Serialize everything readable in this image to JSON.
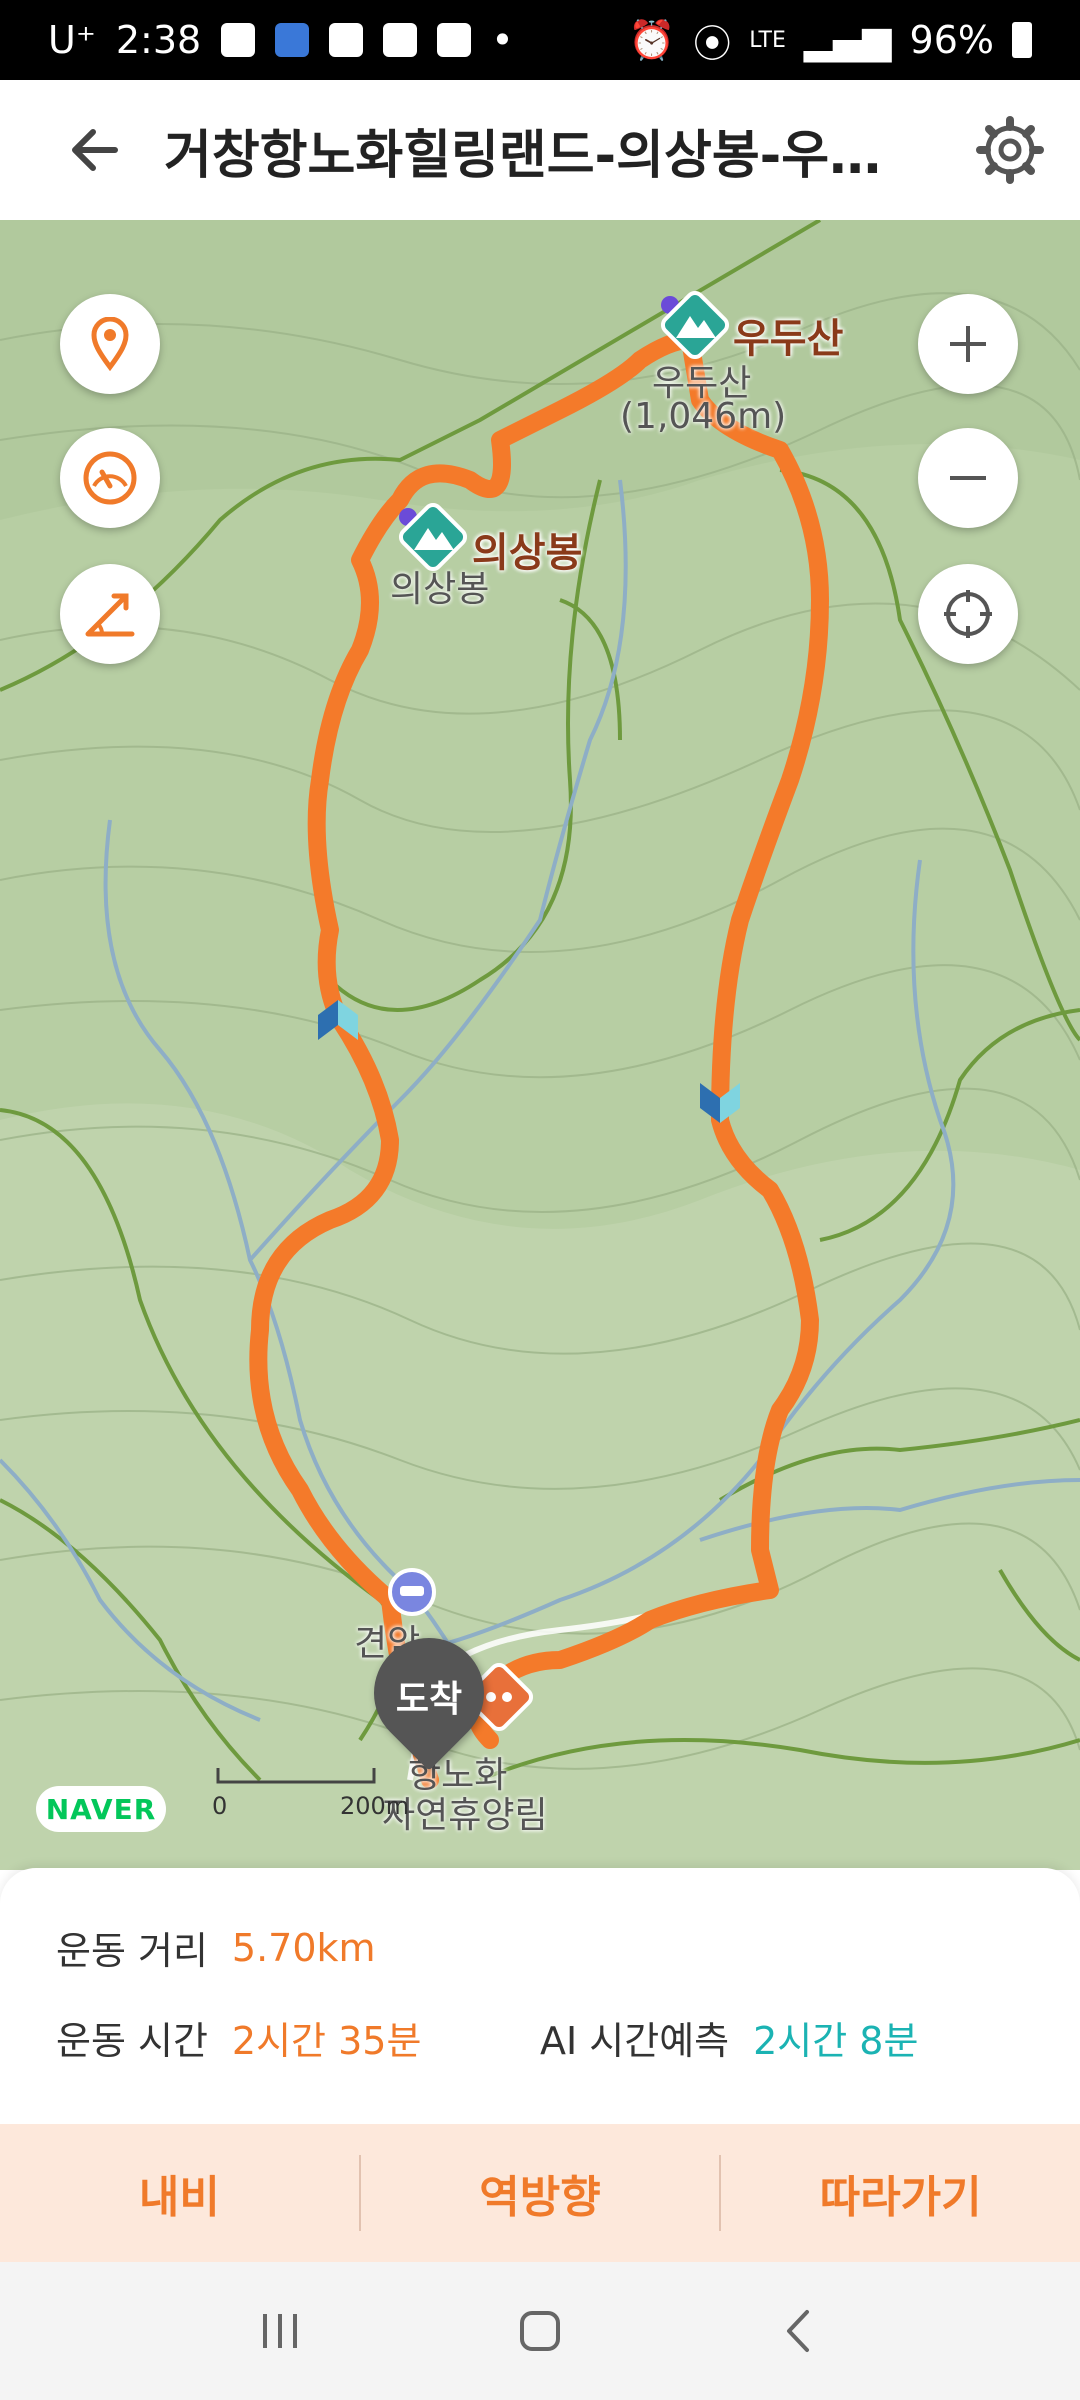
{
  "status_bar": {
    "carrier": "U⁺",
    "time": "2:38",
    "network": "LTE",
    "battery": "96%"
  },
  "header": {
    "title": "거창항노화힐링랜드-의상봉-우…",
    "back_icon": "arrow-left-icon",
    "settings_icon": "gear-icon"
  },
  "map": {
    "peaks": [
      {
        "name": "우두산",
        "label": "우두산",
        "elevation": "(1,046m)"
      },
      {
        "name": "의상봉",
        "label": "의상봉"
      }
    ],
    "places": {
      "facility": "견암",
      "forest_line1": "항노화",
      "forest_line2": "자연휴양림"
    },
    "end_marker": "도착",
    "scale": {
      "start": "0",
      "end": "200m"
    },
    "logo": "NAVER",
    "route_color": "#f47a2a"
  },
  "stats": {
    "distance_label": "운동 거리",
    "distance_value": "5.70km",
    "time_label": "운동 시간",
    "time_value": "2시간 35분",
    "ai_label": "AI 시간예측",
    "ai_value": "2시간 8분"
  },
  "actions": {
    "nav": "내비",
    "reverse": "역방향",
    "follow": "따라가기"
  }
}
